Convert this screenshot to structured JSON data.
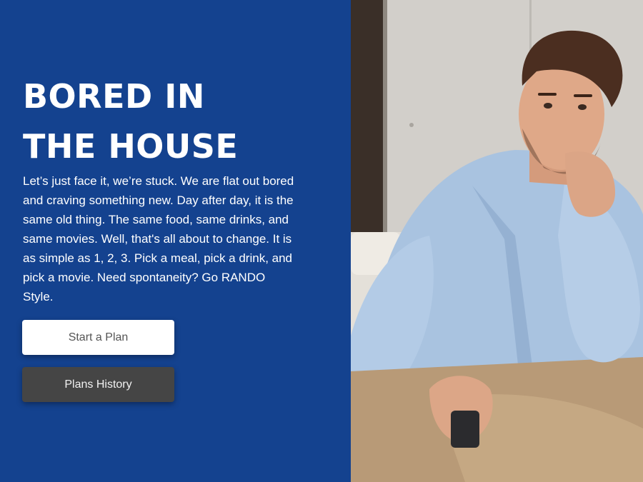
{
  "hero": {
    "title_line1": "BORED IN",
    "title_line2": "THE HOUSE",
    "description": "Let’s just face it, we’re stuck. We are flat out bored and craving something new. Day after day, it is the same old thing. The same food, same drinks, and same movies. Well, that's all about to change. It is as simple as 1, 2, 3. Pick a meal, pick a drink, and pick a movie. Need spontaneity? Go RANDO Style."
  },
  "buttons": {
    "start_plan": "Start a Plan",
    "plans_history": "Plans History"
  },
  "colors": {
    "panel_background": "#14428f",
    "primary_button": "#ffffff",
    "secondary_button": "#454545"
  }
}
